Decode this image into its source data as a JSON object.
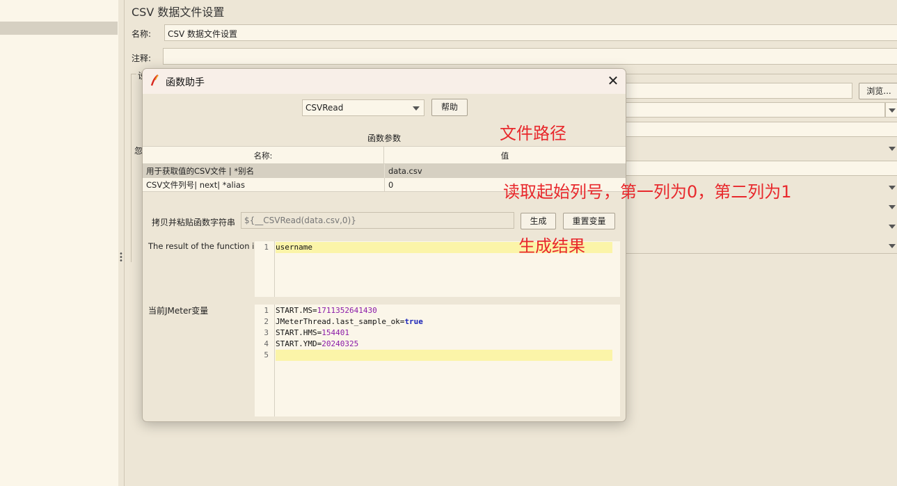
{
  "main": {
    "title": "CSV 数据文件设置",
    "name_label": "名称:",
    "name_value": "CSV 数据文件设置",
    "comment_label": "注释:",
    "comment_value": "",
    "settings_group_initial": "设",
    "ignore_label_initial": "忽",
    "browse_button": "浏览..."
  },
  "dialog": {
    "title": "函数助手",
    "close_icon": "close-icon",
    "function_select": "CSVRead",
    "help_button": "帮助",
    "params_caption": "函数参数",
    "table": {
      "headers": [
        "名称:",
        "值"
      ],
      "rows": [
        {
          "name": "用于获取值的CSV文件 | *别名",
          "value": "data.csv"
        },
        {
          "name": "CSV文件列号| next| *alias",
          "value": "0"
        }
      ]
    },
    "copy_label": "拷贝并粘贴函数字符串",
    "function_string": "${__CSVRead(data.csv,0)}",
    "generate_button": "生成",
    "reset_button": "重置变量",
    "result_label": "The result of the function is",
    "result_lines": [
      {
        "n": "1",
        "text": "username"
      }
    ],
    "vars_label": "当前JMeter变量",
    "vars_lines": [
      {
        "n": "1",
        "key": "START.MS",
        "value": "1711352641430",
        "type": "num"
      },
      {
        "n": "2",
        "key": "JMeterThread.last_sample_ok",
        "value": "true",
        "type": "kw"
      },
      {
        "n": "3",
        "key": "START.HMS",
        "value": "154401",
        "type": "num"
      },
      {
        "n": "4",
        "key": "START.YMD",
        "value": "20240325",
        "type": "num"
      },
      {
        "n": "5",
        "key": "",
        "value": "",
        "type": "empty"
      }
    ]
  },
  "annotations": {
    "file_path": "文件路径",
    "column_note": "读取起始列号，第一列为0，第二列为1",
    "result_note": "生成结果"
  },
  "colors": {
    "annotation": "#e8282c",
    "line_highlight": "#fbf4a8",
    "number": "#8a1aa8",
    "keyword": "#1c25b8"
  }
}
